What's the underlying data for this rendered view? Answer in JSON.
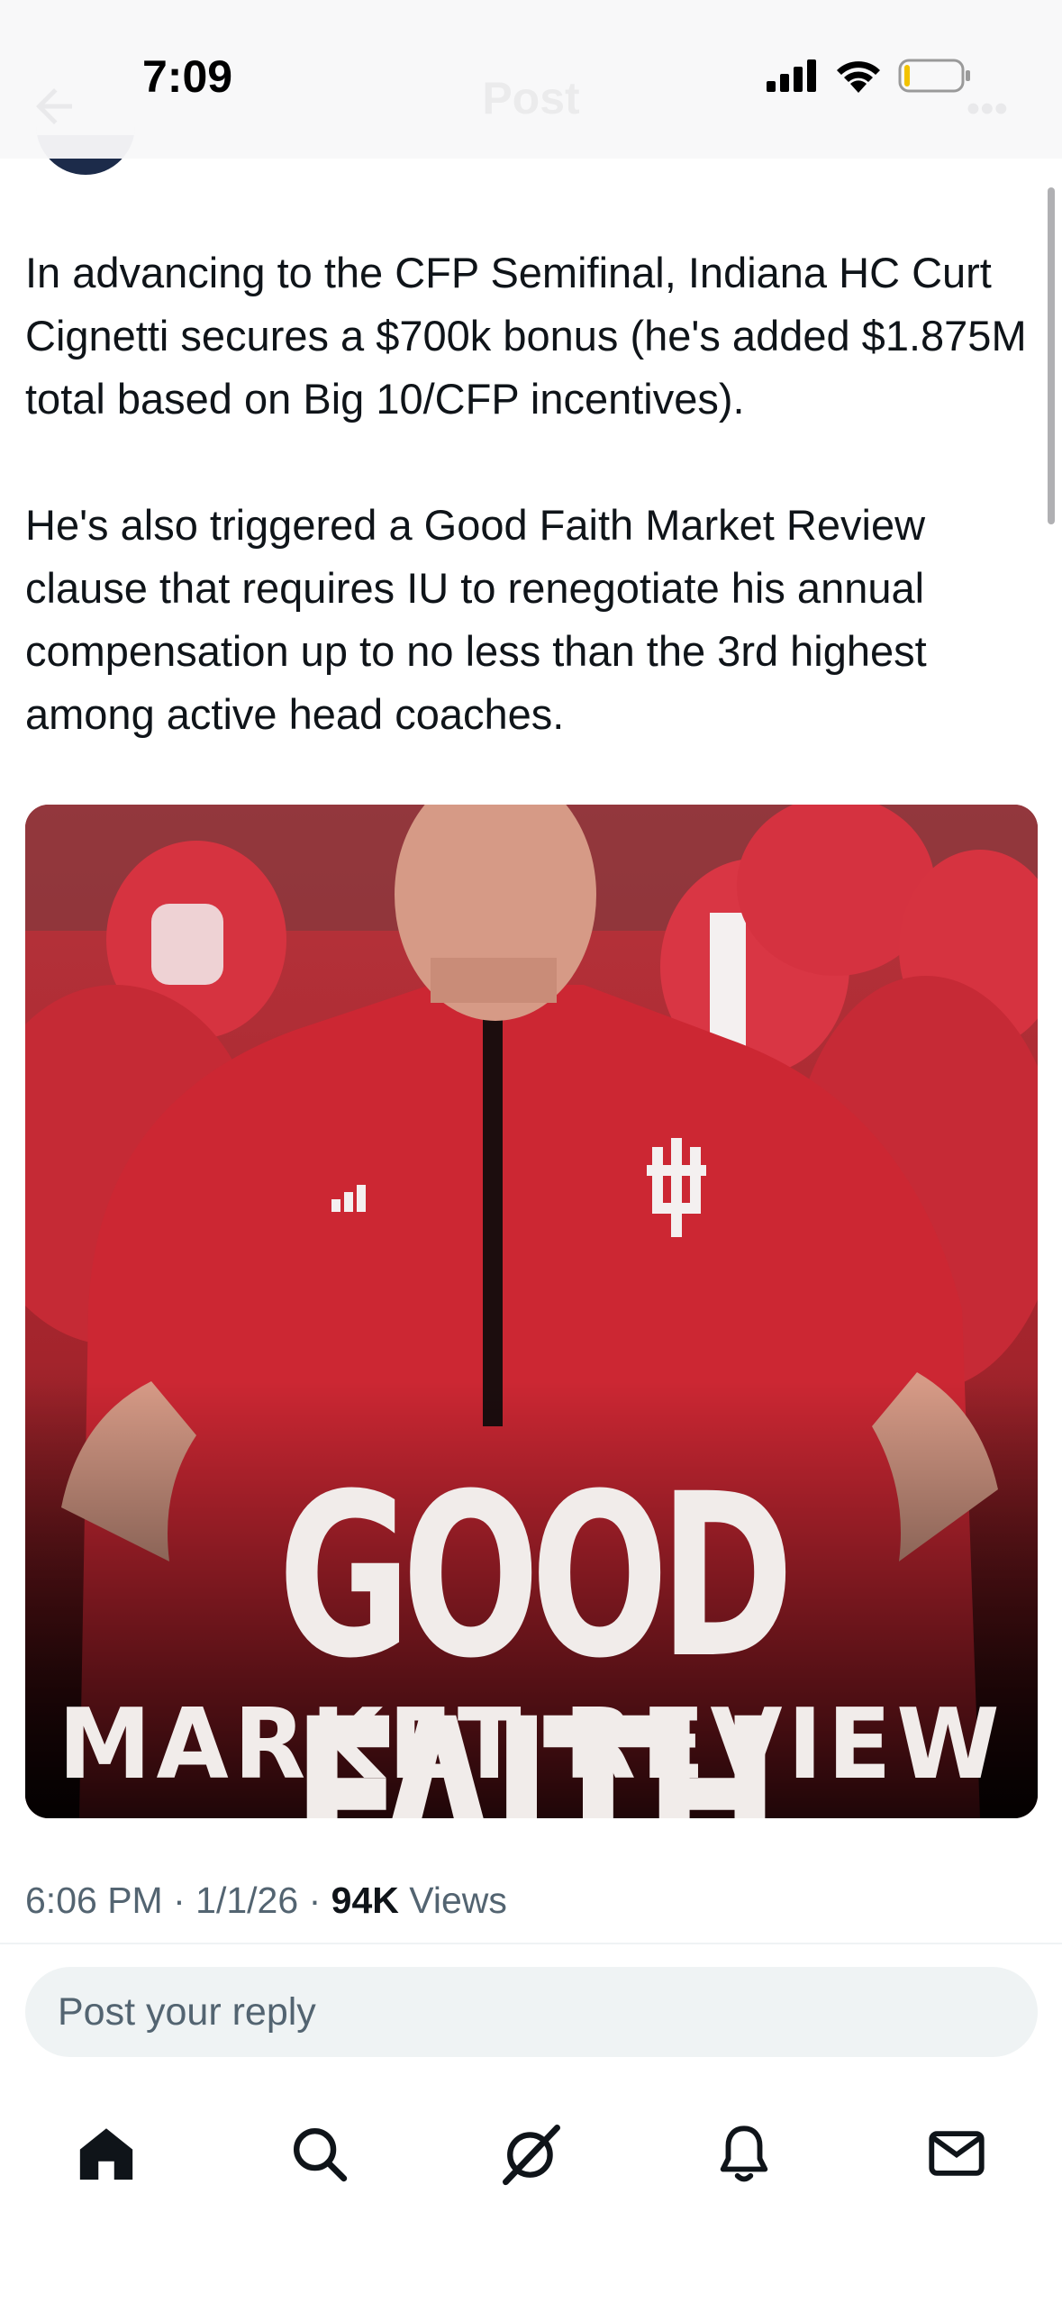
{
  "status_bar": {
    "time": "7:09"
  },
  "header": {
    "title": "Post"
  },
  "tweet": {
    "text": "In advancing to the CFP Semifinal, Indiana HC Curt Cignetti secures a $700k bonus (he's added $1.875M total based on Big 10/CFP incentives).\n\nHe's also triggered a Good Faith Market Review clause that requires IU to renegotiate his annual compensation up to no less than the 3rd highest among active head coaches.",
    "media": {
      "title": "GOOD FAITH",
      "subtitle": "MARKET REVIEW"
    },
    "meta": {
      "time": "6:06 PM",
      "separator": "·",
      "date": "1/1/26",
      "views_count": "94K",
      "views_label": "Views"
    }
  },
  "reply": {
    "placeholder": "Post your reply"
  },
  "nav": {
    "items": [
      {
        "name": "home",
        "icon": "home-icon"
      },
      {
        "name": "search",
        "icon": "search-icon"
      },
      {
        "name": "grok",
        "icon": "grok-icon"
      },
      {
        "name": "notifications",
        "icon": "bell-icon"
      },
      {
        "name": "messages",
        "icon": "mail-icon"
      }
    ]
  },
  "colors": {
    "text": "#0f1419",
    "secondary": "#536471",
    "accent": "#c8102e",
    "reply_bg": "#eff3f4"
  }
}
